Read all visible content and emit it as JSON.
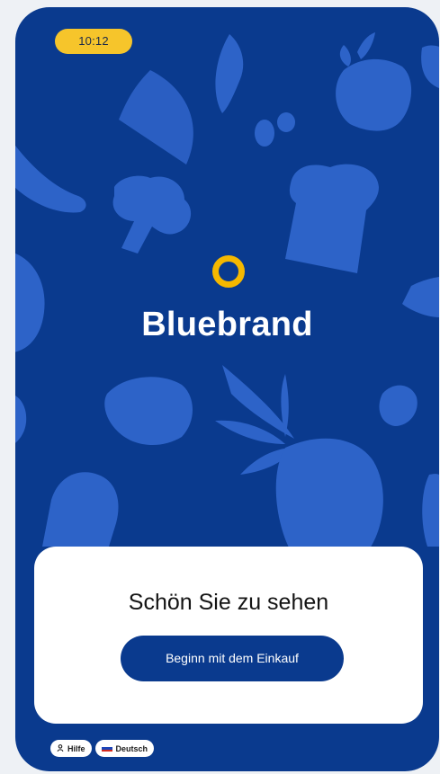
{
  "status_bar": {
    "time": "10:12"
  },
  "brand": {
    "name": "Bluebrand"
  },
  "welcome": {
    "title": "Schön Sie zu sehen",
    "cta_label": "Beginn mit dem Einkauf"
  },
  "footer": {
    "help_label": "Hilfe",
    "language_label": "Deutsch"
  },
  "colors": {
    "background": "#0a3a8e",
    "accent": "#f5b800",
    "illustration": "#2d64c9"
  },
  "icons": {
    "help": "person-icon",
    "language": "flag-icon"
  }
}
